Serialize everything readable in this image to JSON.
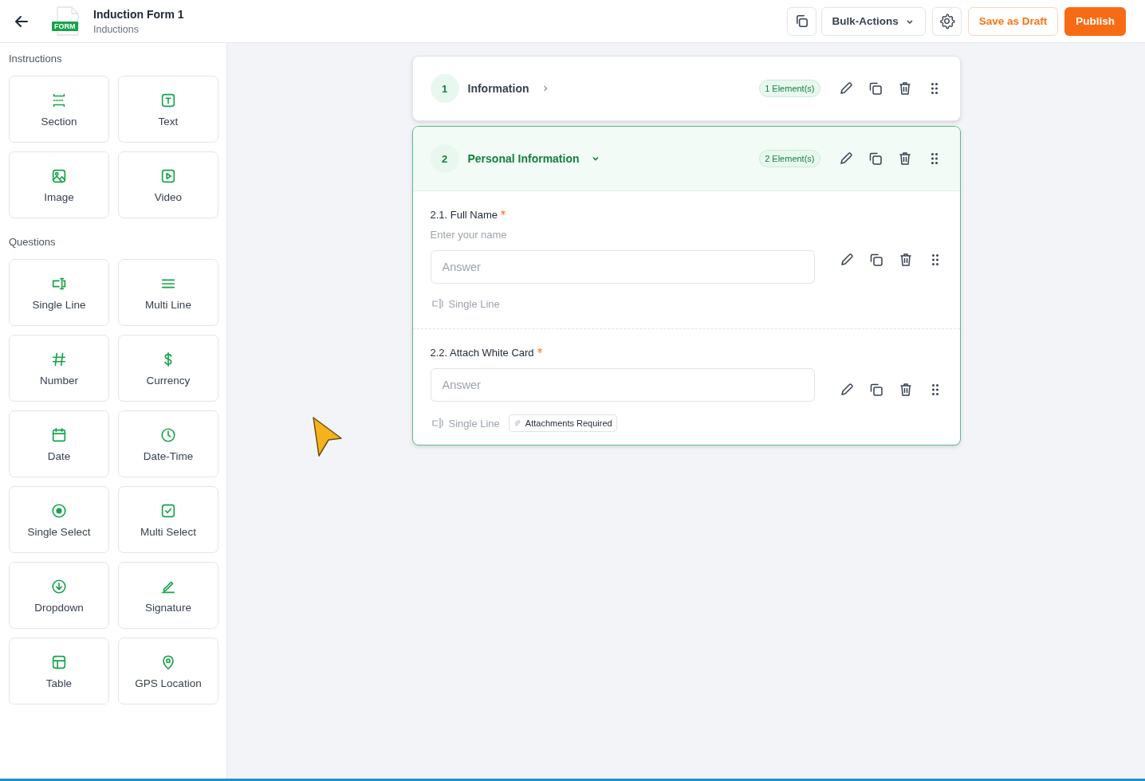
{
  "header": {
    "badge": "FORM",
    "title": "Induction Form 1",
    "subtitle": "Inductions",
    "bulk_actions": "Bulk-Actions",
    "save_draft": "Save as Draft",
    "publish": "Publish"
  },
  "sidebar": {
    "groups": [
      {
        "title": "Instructions",
        "items": [
          {
            "kind": "section",
            "label": "Section"
          },
          {
            "kind": "text",
            "label": "Text"
          },
          {
            "kind": "image",
            "label": "Image"
          },
          {
            "kind": "video",
            "label": "Video"
          }
        ]
      },
      {
        "title": "Questions",
        "items": [
          {
            "kind": "singleline",
            "label": "Single Line"
          },
          {
            "kind": "multiline",
            "label": "Multi Line"
          },
          {
            "kind": "number",
            "label": "Number"
          },
          {
            "kind": "currency",
            "label": "Currency"
          },
          {
            "kind": "date",
            "label": "Date"
          },
          {
            "kind": "datetime",
            "label": "Date-Time"
          },
          {
            "kind": "singleselect",
            "label": "Single Select"
          },
          {
            "kind": "multiselect",
            "label": "Multi Select"
          },
          {
            "kind": "dropdown",
            "label": "Dropdown"
          },
          {
            "kind": "signature",
            "label": "Signature"
          },
          {
            "kind": "table",
            "label": "Table"
          },
          {
            "kind": "gps",
            "label": "GPS Location"
          }
        ]
      }
    ]
  },
  "sections": [
    {
      "number": "1",
      "title": "Information",
      "count": "1 Element(s)",
      "expanded": false
    },
    {
      "number": "2",
      "title": "Personal Information",
      "count": "2 Element(s)",
      "expanded": true,
      "questions": [
        {
          "label": "2.1. Full Name",
          "required": true,
          "description": "Enter your name",
          "placeholder": "Answer",
          "type": "Single Line"
        },
        {
          "label": "2.2. Attach White Card",
          "required": true,
          "placeholder": "Answer",
          "type": "Single Line",
          "tag": "Attachments Required"
        }
      ]
    }
  ]
}
